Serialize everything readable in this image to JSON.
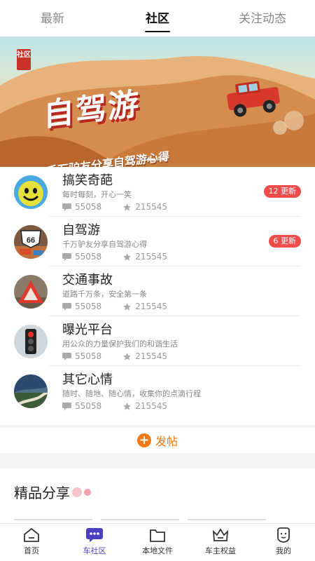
{
  "top_tabs": [
    {
      "label": "最新",
      "active": false
    },
    {
      "label": "社区",
      "active": true
    },
    {
      "label": "关注动态",
      "active": false
    }
  ],
  "banner": {
    "badge": "社区",
    "title": "自驾游",
    "subtitle": "千万驴友分享自驾游心得",
    "slide_count": 2,
    "active_slide": 1
  },
  "communities": [
    {
      "name": "搞笑奇葩",
      "desc": "每时每刻，开心一笑",
      "comments": "55058",
      "likes": "215545",
      "update": "12 更新",
      "icon": "smiley-avatar"
    },
    {
      "name": "自驾游",
      "desc": "千万驴友分享自驾游心得",
      "comments": "55058",
      "likes": "215545",
      "update": "6 更新",
      "icon": "route66-avatar"
    },
    {
      "name": "交通事故",
      "desc": "道路千万条，安全第一条",
      "comments": "55058",
      "likes": "215545",
      "update": "",
      "icon": "warning-triangle-avatar"
    },
    {
      "name": "曝光平台",
      "desc": "用公众的力量保护我们的和谐生活",
      "comments": "55058",
      "likes": "215545",
      "update": "",
      "icon": "traffic-light-avatar"
    },
    {
      "name": "其它心情",
      "desc": "随时、随地、随心情，收集你的点滴行程",
      "comments": "55058",
      "likes": "215545",
      "update": "",
      "icon": "road-landscape-avatar"
    }
  ],
  "post_button": {
    "label": "发帖"
  },
  "featured": {
    "title": "精品分享"
  },
  "bottom_nav": [
    {
      "label": "首页",
      "icon": "home-icon",
      "active": false
    },
    {
      "label": "车社区",
      "icon": "chat-icon",
      "active": true
    },
    {
      "label": "本地文件",
      "icon": "folder-icon",
      "active": false
    },
    {
      "label": "车主权益",
      "icon": "crown-icon",
      "active": false
    },
    {
      "label": "我的",
      "icon": "profile-icon",
      "active": false
    }
  ],
  "colors": {
    "accent": "#4a3fc0",
    "badge_red": "#ee4b4b",
    "post_orange": "#f07a1a"
  }
}
